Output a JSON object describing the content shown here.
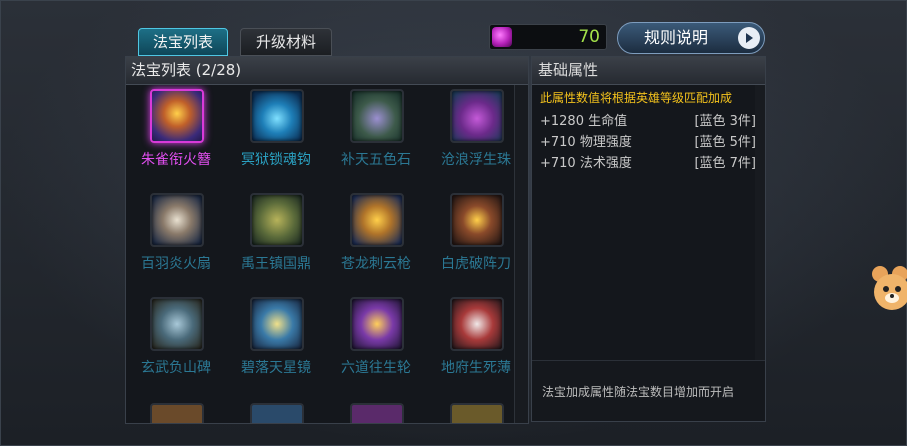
{
  "tabs": [
    {
      "label": "法宝列表",
      "active": true
    },
    {
      "label": "升级材料",
      "active": false
    }
  ],
  "currency": {
    "icon": "purple-gem-icon",
    "value": "70"
  },
  "rules_button": {
    "label": "规则说明",
    "icon": "play-arrow-icon"
  },
  "list_panel": {
    "title": "法宝列表 (2/28)",
    "items": [
      {
        "name": "朱雀衔火簪",
        "icon": "phoenix-hairpin-icon",
        "state": "selected",
        "color": "#e24ff0"
      },
      {
        "name": "冥狱锁魂钩",
        "icon": "hook-icon",
        "state": "owned",
        "color": "#2aa1c2"
      },
      {
        "name": "补天五色石",
        "icon": "crystal-stone-icon",
        "state": "locked",
        "color": "#2b7894"
      },
      {
        "name": "沧浪浮生珠",
        "icon": "orb-icon",
        "state": "locked",
        "color": "#2b7894"
      },
      {
        "name": "百羽炎火扇",
        "icon": "feather-fan-icon",
        "state": "locked",
        "color": "#2b7894"
      },
      {
        "name": "禹王镇国鼎",
        "icon": "cauldron-icon",
        "state": "locked",
        "color": "#2b7894"
      },
      {
        "name": "苍龙刺云枪",
        "icon": "spear-icon",
        "state": "locked",
        "color": "#2b7894"
      },
      {
        "name": "白虎破阵刀",
        "icon": "blade-icon",
        "state": "locked",
        "color": "#2b7894"
      },
      {
        "name": "玄武负山碑",
        "icon": "stele-icon",
        "state": "locked",
        "color": "#2b7894"
      },
      {
        "name": "碧落天星镜",
        "icon": "mirror-icon",
        "state": "locked",
        "color": "#2b7894"
      },
      {
        "name": "六道往生轮",
        "icon": "wheel-icon",
        "state": "locked",
        "color": "#2b7894"
      },
      {
        "name": "地府生死薄",
        "icon": "book-icon",
        "state": "locked",
        "color": "#2b7894"
      }
    ]
  },
  "attr_panel": {
    "title": "基础属性",
    "note": "此属性数值将根据英雄等级匹配加成",
    "stats": [
      {
        "value": "+1280 生命值",
        "requirement": "[蓝色 3件]"
      },
      {
        "value": "+710 物理强度",
        "requirement": "[蓝色 5件]"
      },
      {
        "value": "+710 法术强度",
        "requirement": "[蓝色 7件]"
      }
    ],
    "footer": "法宝加成属性随法宝数目增加而开启"
  },
  "mascot": {
    "icon": "bear-mascot-icon"
  }
}
